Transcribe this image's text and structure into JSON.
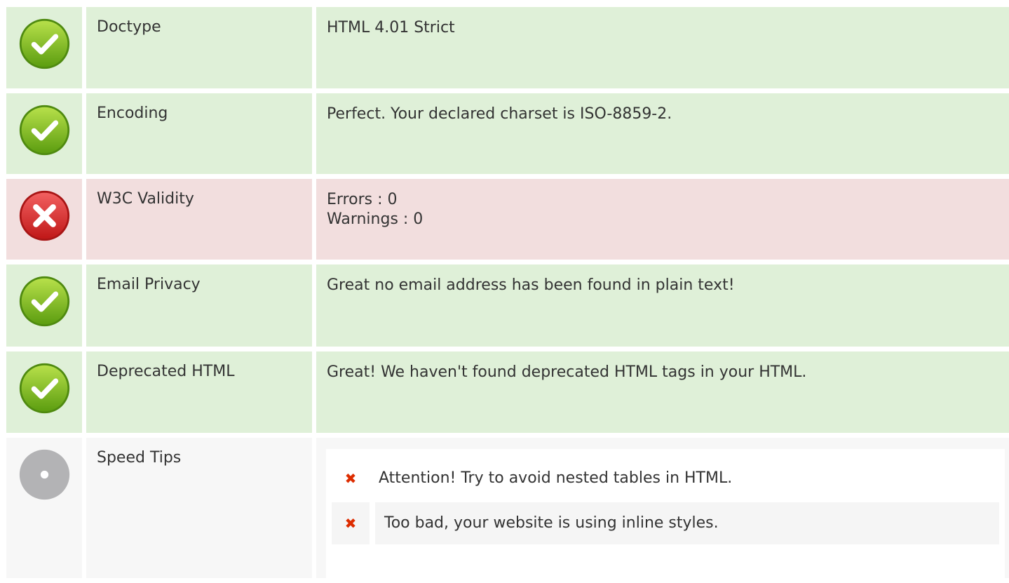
{
  "rows": [
    {
      "status": "pass",
      "label": "Doctype",
      "value": "HTML 4.01 Strict"
    },
    {
      "status": "pass",
      "label": "Encoding",
      "value": "Perfect. Your declared charset is ISO-8859-2."
    },
    {
      "status": "fail",
      "label": "W3C Validity",
      "value_line1": "Errors : 0",
      "value_line2": "Warnings : 0"
    },
    {
      "status": "pass",
      "label": "Email Privacy",
      "value": "Great no email address has been found in plain text!"
    },
    {
      "status": "pass",
      "label": "Deprecated HTML",
      "value": "Great! We haven't found deprecated HTML tags in your HTML."
    },
    {
      "status": "info",
      "label": "Speed Tips"
    }
  ],
  "speed_tips": [
    {
      "text": "Attention! Try to avoid nested tables in HTML.",
      "icon": "cross-mark-icon"
    },
    {
      "text": "Too bad, your website is using inline styles.",
      "icon": "cross-mark-icon"
    }
  ],
  "icons": {
    "pass": "check-circle-icon",
    "fail": "error-circle-icon",
    "info": "neutral-circle-icon"
  },
  "colors": {
    "pass_bg": "#dff0d8",
    "fail_bg": "#f2dede",
    "info_bg": "#f7f7f7",
    "cross": "#dd2c00"
  }
}
